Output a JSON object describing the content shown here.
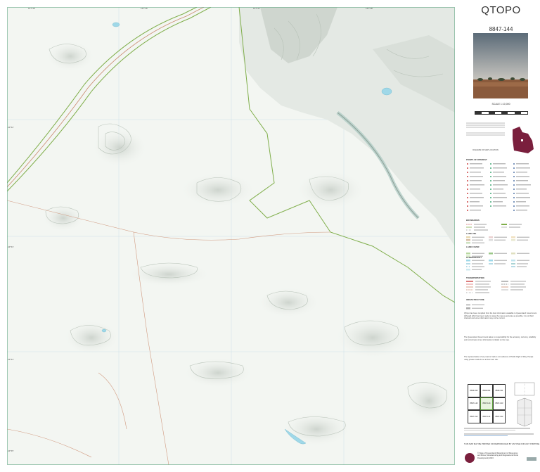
{
  "map": {
    "title": "QTOPO",
    "sheet_number": "8847-144",
    "scale": "SCALE 1:10,000",
    "top_ticks": [
      "147°45'",
      "147°46'",
      "147°47'",
      "147°48'"
    ],
    "left_ticks": [
      "24°52'",
      "24°53'",
      "24°54'",
      "24°55'"
    ],
    "colors": {
      "terrain": "#f3f6f2",
      "hillshade": "#d5dbd5",
      "boundary": "#7fae4a",
      "road": "#c9886e",
      "water": "#9fd8e8",
      "grid": "#c5dde7"
    }
  },
  "panel": {
    "map_info": "DIAGRAM OF MAP LOCATION",
    "legend_heading_1": "POINTS OF INTEREST",
    "legend_heading_2": "BOUNDARIES",
    "legend_heading_3": "LAND USE",
    "legend_heading_4": "LAND COVER",
    "legend_heading_5": "HYDROGRAPHY",
    "legend_heading_6": "TRANSPORTATION",
    "legend_heading_7": "INFRASTRUCTURE",
    "para_1": "QTopo has been compiled from the best information available to Queensland Government. Although effort has been made to make the map as accurate as possible, it is not field checked and some information may not be current.",
    "para_2": "The Queensland Government takes no responsibility for the accuracy, currency, reliability and correctness of any information included on the map.",
    "para_3": "The representation of any road or track is not evidence of Public Right of Way. People using private roads do so at their own risk.",
    "index_cells": [
      "8849-322",
      "8849-321",
      "8849-311",
      "8847-142",
      "8847-144",
      "8847-143",
      "8847-312",
      "8847-141",
      "8847-132"
    ],
    "footer_note": "THIS MAP MAY BE PRINTED OR REPRODUCED BY ANYONE FOR ANY PURPOSE",
    "organisation": "© State of Queensland (Department of Resources and Mines, Manufacturing and Regional and Rural Development) 2023"
  }
}
